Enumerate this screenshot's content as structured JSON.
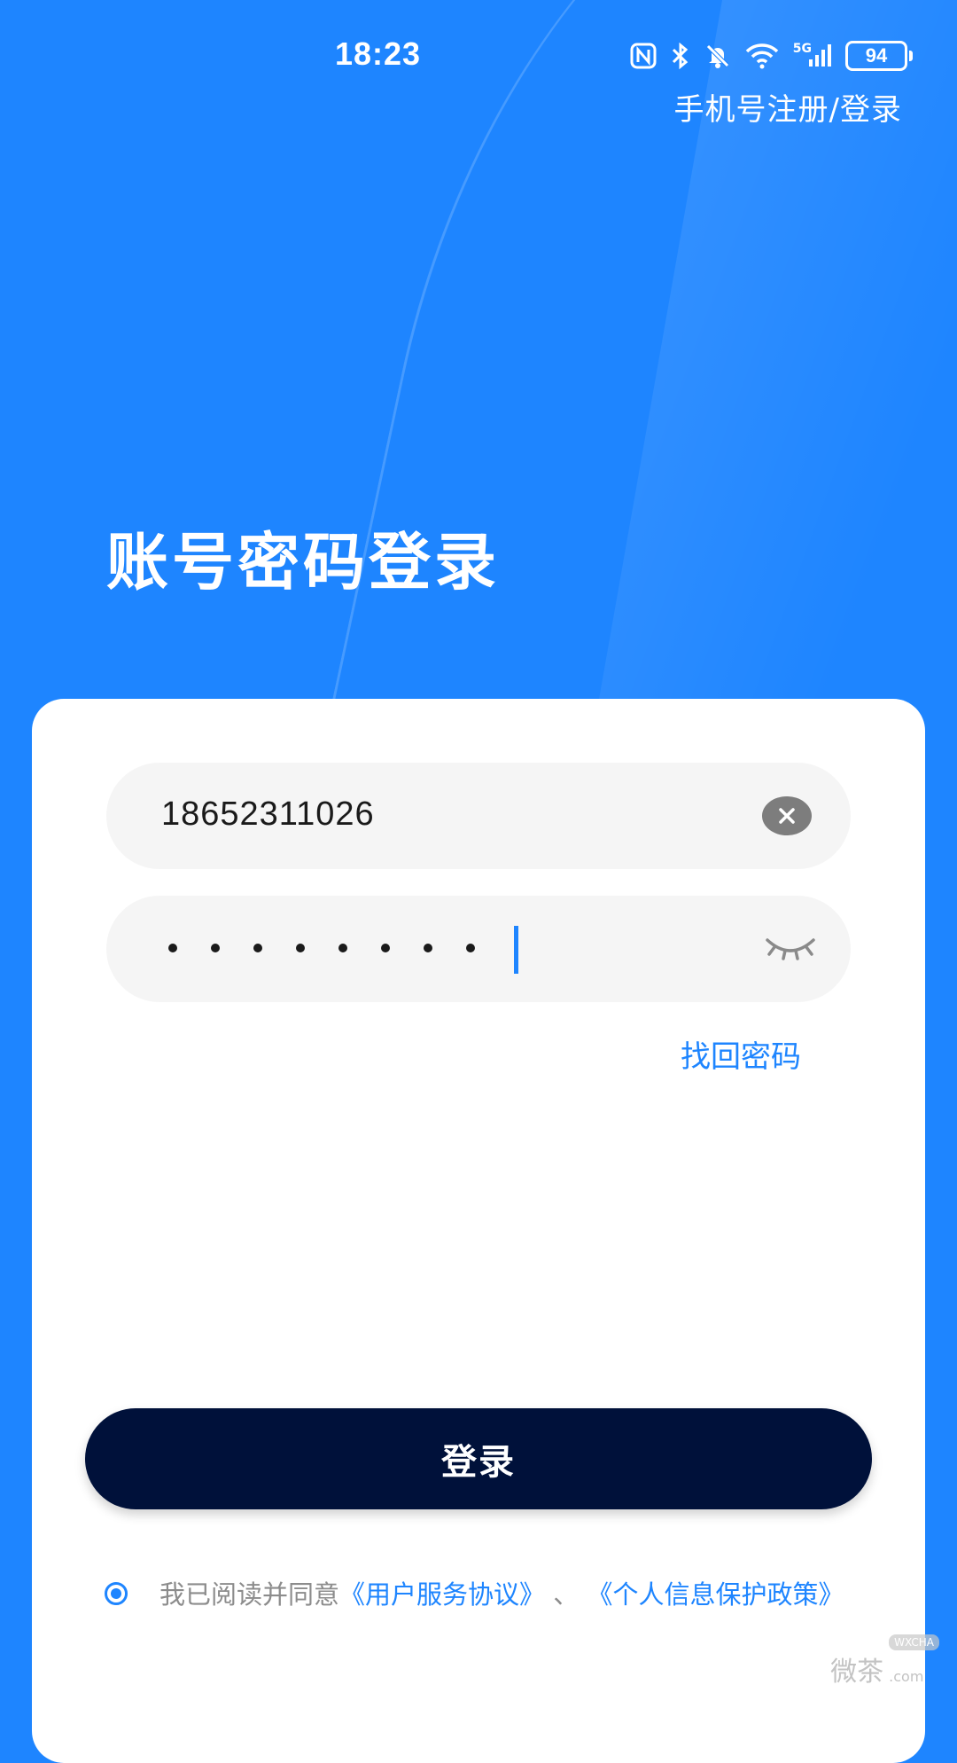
{
  "status_bar": {
    "time": "18:23",
    "network": "5G",
    "battery": "94"
  },
  "header": {
    "register_link": "手机号注册/登录"
  },
  "page": {
    "title": "账号密码登录"
  },
  "form": {
    "account_value": "18652311026",
    "password_dot_count": 8,
    "forgot_password": "找回密码",
    "login_button": "登录"
  },
  "agreement": {
    "prefix": "我已阅读并同意",
    "user_agreement": "《用户服务协议》",
    "separator": "、",
    "privacy_policy": "《个人信息保护政策》"
  },
  "watermark": {
    "text": "微茶",
    "badge": "WXCHA",
    "domain": ".com"
  },
  "colors": {
    "background": "#1E85FF",
    "accent": "#1E85FF",
    "button": "#00113A",
    "field_bg": "#F5F5F5"
  }
}
